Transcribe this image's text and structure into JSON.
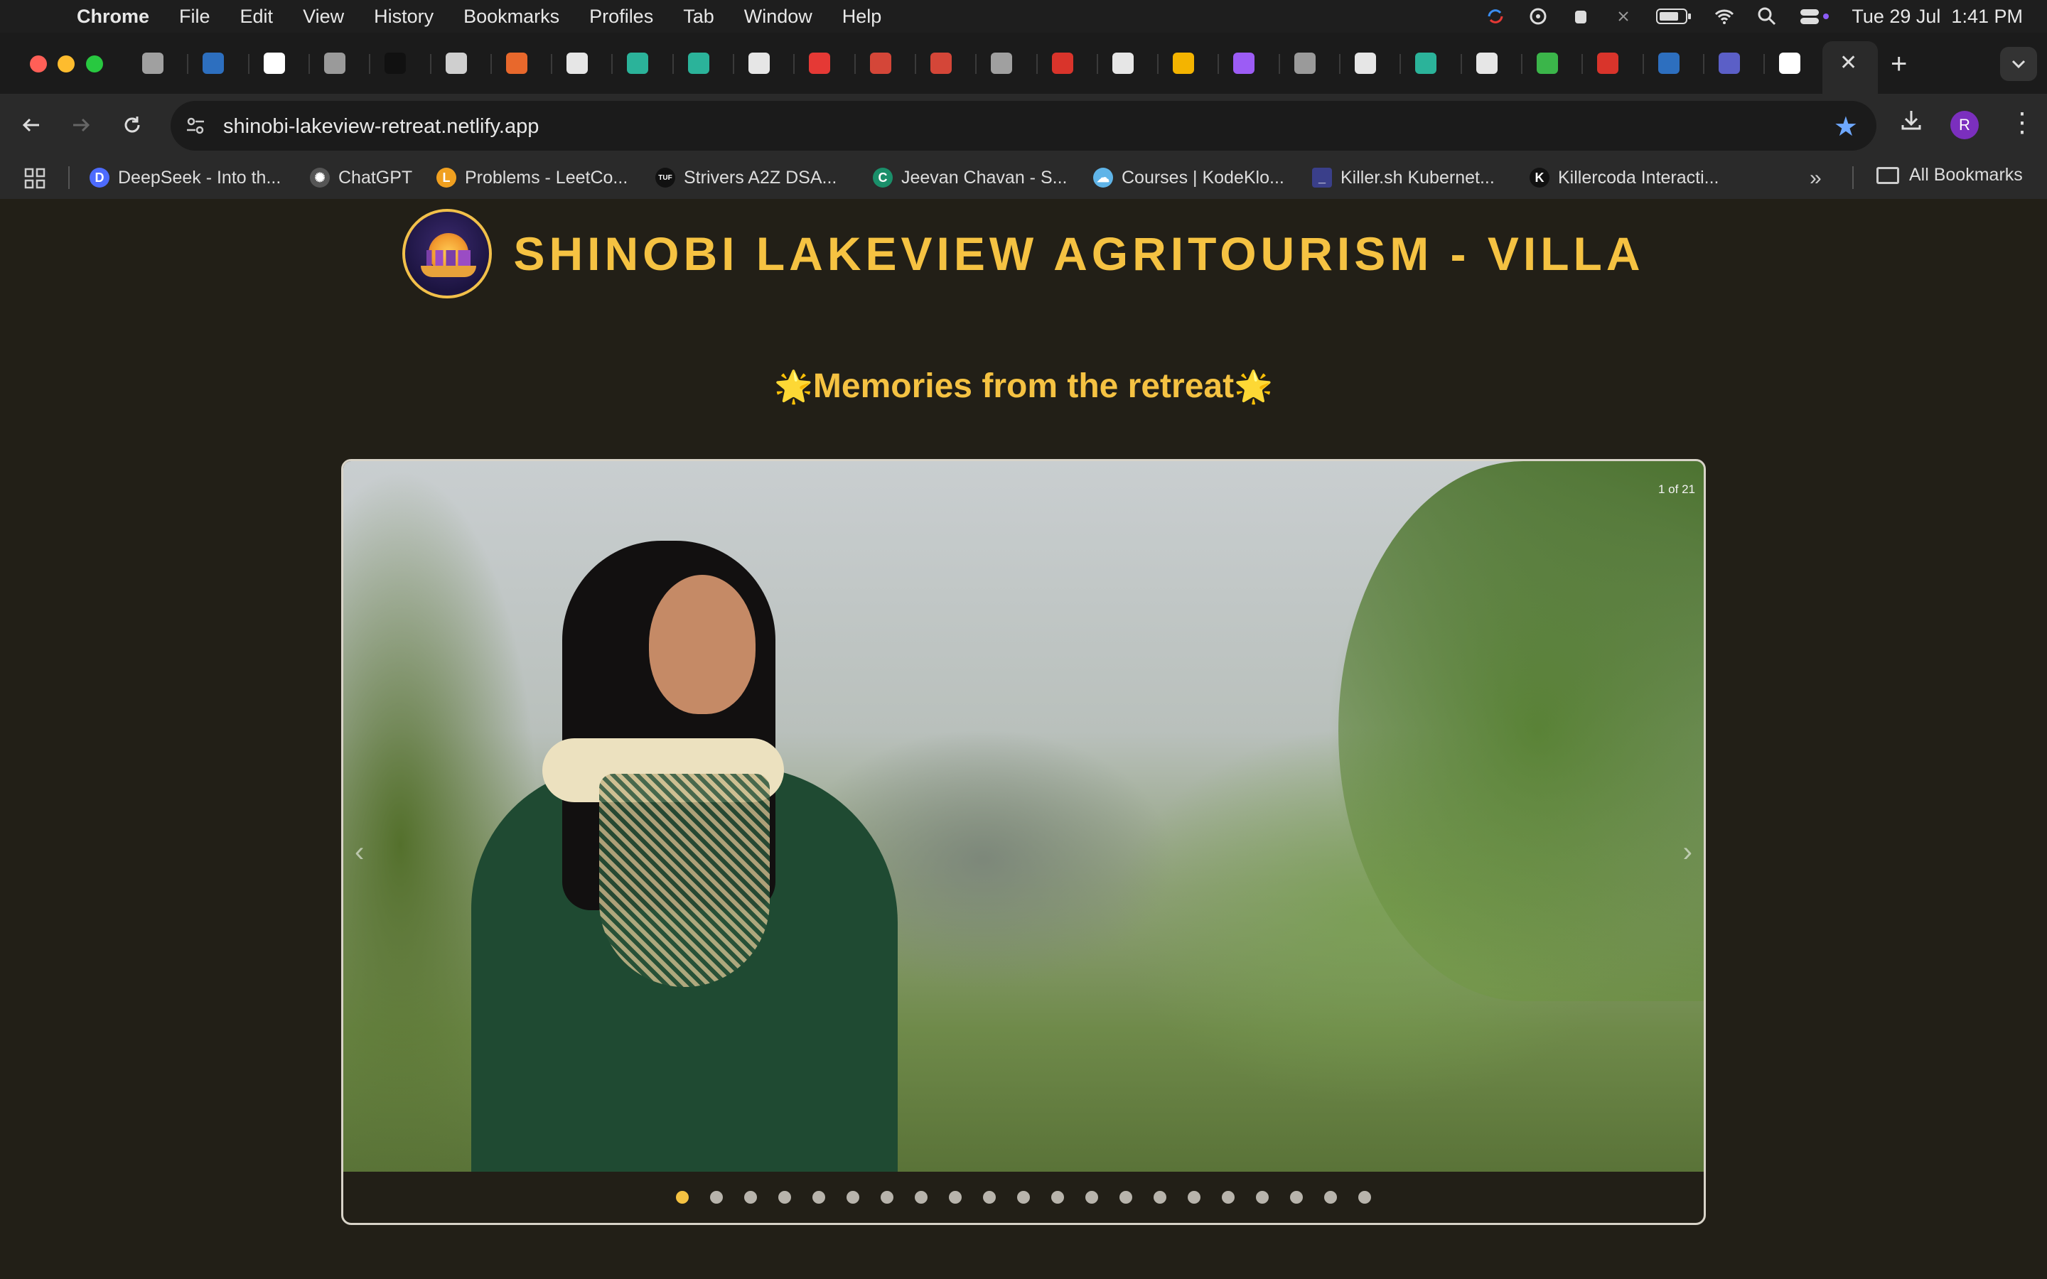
{
  "menubar": {
    "app_name": "Chrome",
    "items": [
      "File",
      "Edit",
      "View",
      "History",
      "Bookmarks",
      "Profiles",
      "Tab",
      "Window",
      "Help"
    ],
    "datetime": "Tue 29 Jul  1:41 PM",
    "status_icons": [
      "sync-icon",
      "password-icon",
      "alarm-icon",
      "bluetooth-icon",
      "battery-icon",
      "wifi-icon",
      "spotlight-search-icon",
      "control-center-icon"
    ]
  },
  "tabs": {
    "favicons": [
      "elephant-icon",
      "linkedin-icon",
      "rc-icon",
      "globe-icon",
      "tuf-icon",
      "chatgpt-icon",
      "chart-icon",
      "github-icon",
      "diamond-icon",
      "task-icon",
      "github-icon",
      "youtube-icon",
      "gmail-icon",
      "gmail-icon",
      "elephant-icon",
      "pin-icon",
      "github-icon",
      "drive-icon",
      "vite-icon",
      "globe-icon",
      "github-icon",
      "diamond-icon",
      "github-icon",
      "chat-icon",
      "pin-icon",
      "linkedin-icon",
      "teams-icon",
      "google-icon"
    ],
    "favicon_colors": [
      "#a0a0a0",
      "#2d6fbf",
      "#ffffff",
      "#9a9a9a",
      "#111111",
      "#cfcfcf",
      "#e8682c",
      "#e6e6e6",
      "#2bb39a",
      "#2bb39a",
      "#e6e6e6",
      "#e53935",
      "#d44638",
      "#d44638",
      "#a0a0a0",
      "#d9342b",
      "#e6e6e6",
      "#f4b400",
      "#9c5cf5",
      "#9a9a9a",
      "#e6e6e6",
      "#2bb39a",
      "#e6e6e6",
      "#3bb54a",
      "#d9342b",
      "#2d6fbf",
      "#5b5fc7",
      "#ffffff"
    ],
    "active_close": "✕",
    "new_tab": "+"
  },
  "toolbar": {
    "url": "shinobi-lakeview-retreat.netlify.app",
    "profile_initial": "R"
  },
  "bookmarks": {
    "items": [
      {
        "label": "DeepSeek - Into th...",
        "icon": "deepseek-icon",
        "color": "#4d6bfe"
      },
      {
        "label": "ChatGPT",
        "icon": "chatgpt-icon",
        "color": "#cfcfcf"
      },
      {
        "label": "Problems - LeetCo...",
        "icon": "leetcode-icon",
        "color": "#f0a020"
      },
      {
        "label": "Strivers A2Z DSA...",
        "icon": "tuf-icon",
        "color": "#111111"
      },
      {
        "label": "Jeevan Chavan - S...",
        "icon": "c-icon",
        "color": "#1a8f6a"
      },
      {
        "label": "Courses | KodeKlo...",
        "icon": "kodekloud-icon",
        "color": "#5fb4e8"
      },
      {
        "label": "Killer.sh Kubernet...",
        "icon": "terminal-icon",
        "color": "#3a3f8a"
      },
      {
        "label": "Killercoda Interacti...",
        "icon": "k-icon",
        "color": "#111111"
      }
    ],
    "all_label": "All Bookmarks"
  },
  "site": {
    "title": "SHINOBI LAKEVIEW AGRITOURISM - VILLA",
    "section_title": "Memories from the retreat",
    "star": "🌟"
  },
  "carousel": {
    "counter": "1 of 21",
    "total": 21,
    "current": 1,
    "dots_visible": 21,
    "prev_arrow": "‹",
    "next_arrow": "›"
  }
}
